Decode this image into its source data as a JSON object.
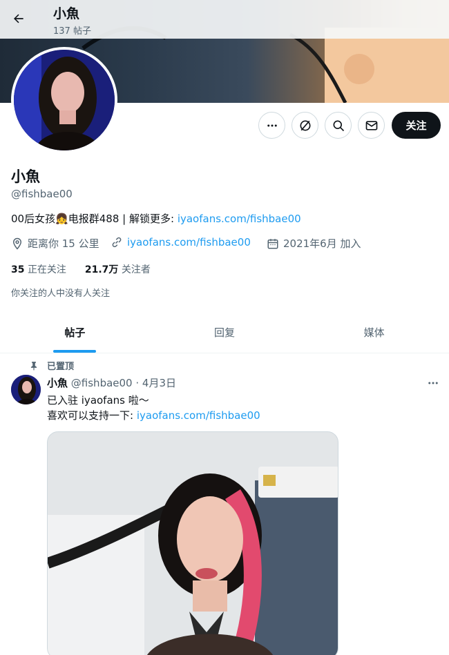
{
  "header": {
    "title": "小魚",
    "post_count": "137 帖子"
  },
  "profile": {
    "name": "小魚",
    "handle": "@fishbae00",
    "bio_text": "00后女孩👧电报群488 | 解锁更多: ",
    "bio_link": "iyaofans.com/fishbae00",
    "location": "距离你 15 公里",
    "website": "iyaofans.com/fishbae00",
    "joined": "2021年6月 加入",
    "following_count": "35",
    "following_label": "正在关注",
    "followers_count": "21.7万",
    "followers_label": "关注者",
    "followed_by": "你关注的人中没有人关注"
  },
  "actions": {
    "follow_label": "关注"
  },
  "tabs": [
    {
      "label": "帖子",
      "active": true
    },
    {
      "label": "回复",
      "active": false
    },
    {
      "label": "媒体",
      "active": false
    }
  ],
  "post": {
    "pinned_label": "已置顶",
    "author_name": "小魚",
    "author_handle": "@fishbae00",
    "separator": " · ",
    "date": "4月3日",
    "line1": "已入驻 iyaofans 啦～",
    "line2_text": "喜欢可以支持一下: ",
    "line2_link": "iyaofans.com/fishbae00"
  },
  "colors": {
    "accent": "#1d9bf0",
    "text": "#0f1419",
    "secondary": "#536471",
    "button_dark": "#0f1419"
  },
  "icons": [
    "back-arrow-icon",
    "more-icon",
    "subscribe-icon",
    "search-icon",
    "mail-icon",
    "location-icon",
    "link-icon",
    "calendar-icon",
    "pin-icon"
  ]
}
